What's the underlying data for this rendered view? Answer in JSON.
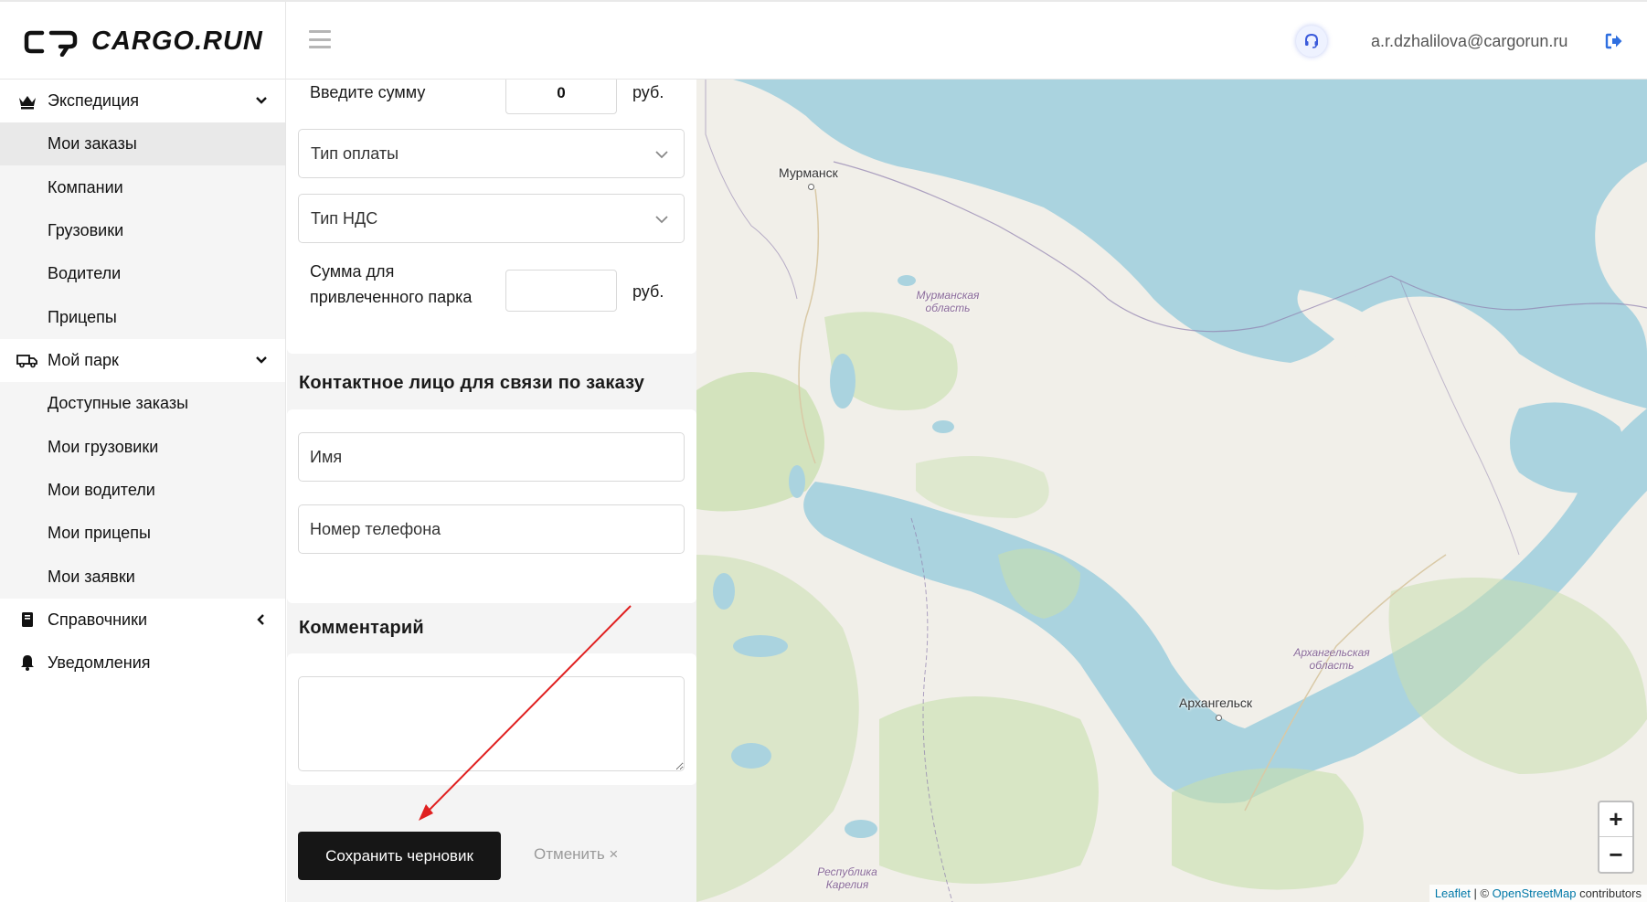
{
  "header": {
    "logo_text": "CARGO.RUN",
    "user_email": "a.r.dzhalilova@cargorun.ru",
    "icons": {
      "menu": "hamburger-icon",
      "support": "headset-icon",
      "logout": "logout-icon"
    }
  },
  "sidebar": {
    "groups": [
      {
        "label": "Экспедиция",
        "icon": "crown-icon",
        "state": "expanded",
        "items": [
          "Мои заказы",
          "Компании",
          "Грузовики",
          "Водители",
          "Прицепы"
        ],
        "active_index": 0
      },
      {
        "label": "Мой парк",
        "icon": "truck-icon",
        "state": "expanded",
        "items": [
          "Доступные заказы",
          "Мои грузовики",
          "Мои водители",
          "Мои прицепы",
          "Мои заявки"
        ]
      },
      {
        "label": "Справочники",
        "icon": "book-icon",
        "state": "collapsed"
      },
      {
        "label": "Уведомления",
        "icon": "bell-icon"
      }
    ]
  },
  "form": {
    "amount_label": "Введите сумму",
    "amount_value": "0",
    "currency": "руб.",
    "payment_type_placeholder": "Тип оплаты",
    "vat_type_placeholder": "Тип НДС",
    "fleet_amount_label_line1": "Сумма для",
    "fleet_amount_label_line2": "привлеченного парка",
    "fleet_amount_value": "",
    "contact_section_title": "Контактное лицо для связи по заказу",
    "name_placeholder": "Имя",
    "phone_placeholder": "Номер телефона",
    "comment_section_title": "Комментарий",
    "comment_value": "",
    "save_button": "Сохранить черновик",
    "cancel_button": "Отменить ×"
  },
  "map": {
    "cities": [
      "Мурманск",
      "Архангельск"
    ],
    "regions": [
      "Мурманская область",
      "Архангельская область",
      "Республика Карелия"
    ],
    "zoom_in": "+",
    "zoom_out": "−",
    "attribution_leaflet": "Leaflet",
    "attribution_sep": " | © ",
    "attribution_osm": "OpenStreetMap",
    "attribution_suffix": " contributors"
  },
  "colors": {
    "accent_dark": "#161616",
    "arrow": "#e02020",
    "water": "#aad3df",
    "land": "#f1efe9",
    "forest": "#c8dfae",
    "link": "#0078a8"
  }
}
